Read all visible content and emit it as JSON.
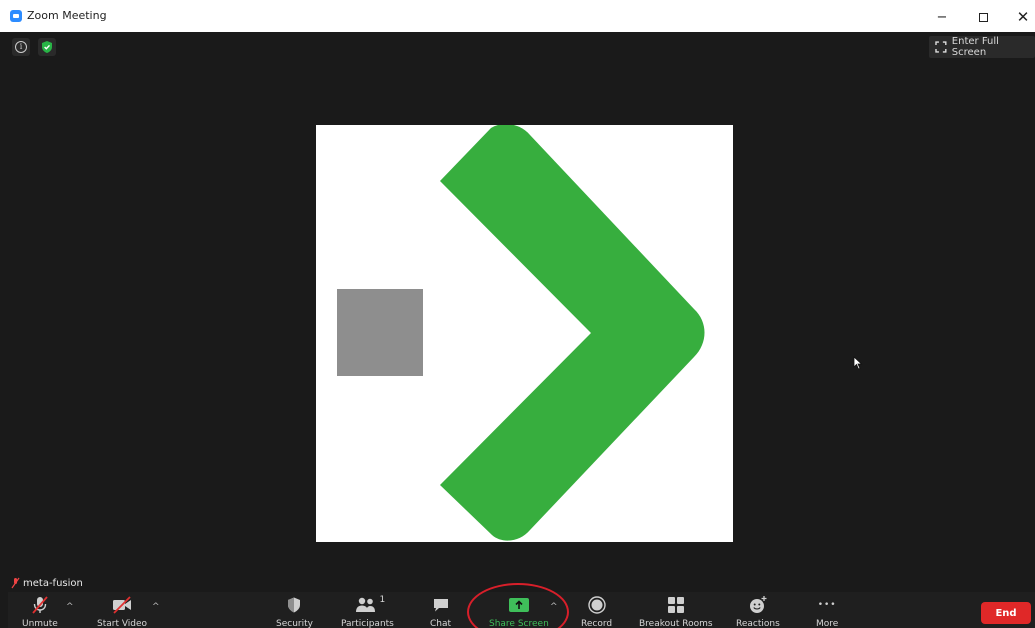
{
  "window": {
    "title": "Zoom Meeting",
    "minimize": "−",
    "close": "✕"
  },
  "meeting": {
    "fullscreen_label": "Enter Full Screen",
    "info_glyph": "i",
    "participant_name": "meta-fusion",
    "colors": {
      "chevron": "#37ae3e",
      "square": "#8e8e8e",
      "canvas": "#ffffff",
      "background": "#1a1a1a"
    }
  },
  "toolbar": {
    "unmute": "Unmute",
    "start_video": "Start Video",
    "security": "Security",
    "participants": "Participants",
    "participants_count": "1",
    "chat": "Chat",
    "share_screen": "Share Screen",
    "record": "Record",
    "breakout_rooms": "Breakout Rooms",
    "reactions": "Reactions",
    "more": "More",
    "more_glyph": "•••",
    "caret": "^",
    "end": "End",
    "colors": {
      "share_accent": "#3fbf5a",
      "end": "#e02828",
      "highlight": "#d81f2a"
    }
  }
}
